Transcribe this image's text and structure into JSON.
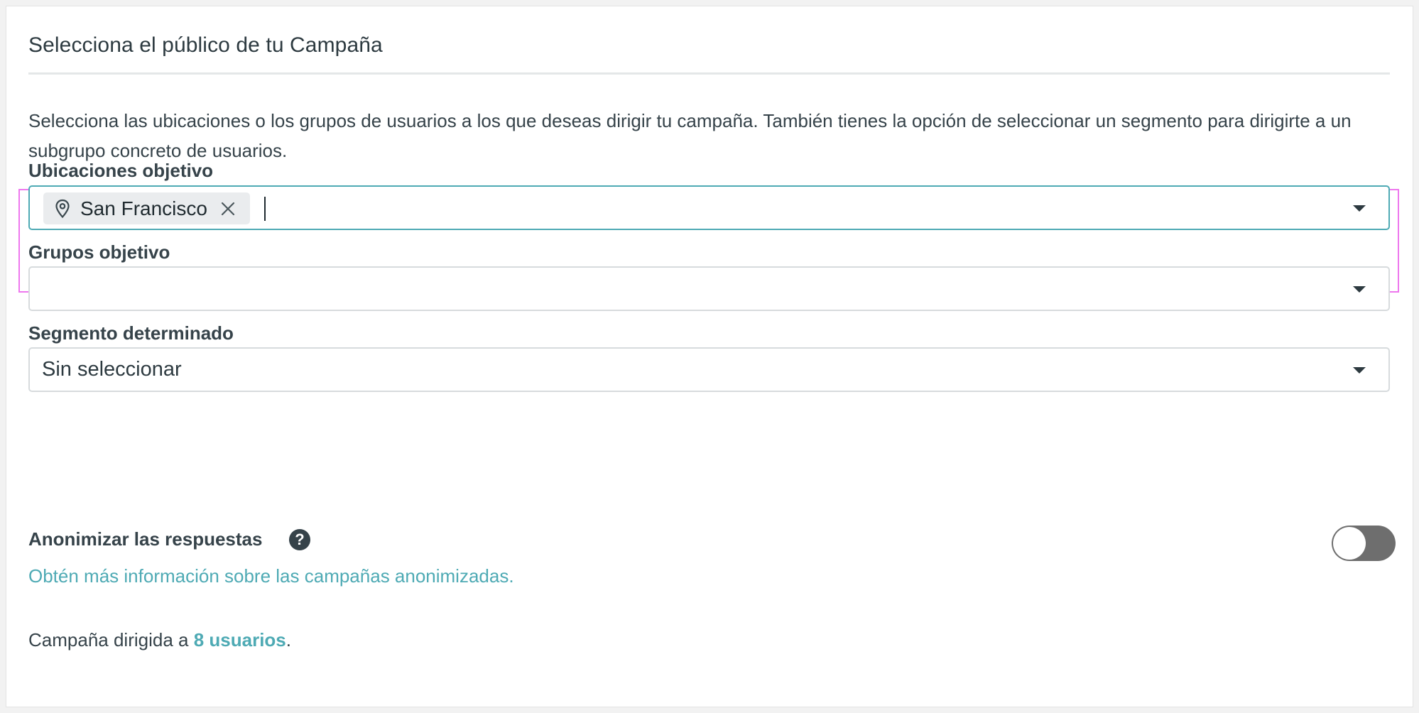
{
  "section": {
    "title": "Selecciona el público de tu Campaña",
    "description": "Selecciona las ubicaciones o los grupos de usuarios a los que deseas dirigir tu campaña. También tienes la opción de seleccionar un segmento para dirigirte a un subgrupo concreto de usuarios."
  },
  "locations": {
    "label": "Ubicaciones objetivo",
    "selected": [
      {
        "label": "San Francisco",
        "icon": "map-pin-icon"
      }
    ],
    "input_value": ""
  },
  "groups": {
    "label": "Grupos objetivo",
    "value": ""
  },
  "segment": {
    "label": "Segmento determinado",
    "value": "Sin seleccionar"
  },
  "anonymize": {
    "label": "Anonimizar las respuestas",
    "help_icon": "question-circle-icon",
    "help_glyph": "?",
    "link": "Obtén más información sobre las campañas anonimizadas.",
    "enabled": false
  },
  "summary": {
    "prefix": "Campaña dirigida a ",
    "count_text": "8 usuarios",
    "suffix": "."
  },
  "colors": {
    "accent": "#4eaab4",
    "highlight": "#ee77ee",
    "toggle_off": "#6e6e6e",
    "text": "#36434a"
  }
}
